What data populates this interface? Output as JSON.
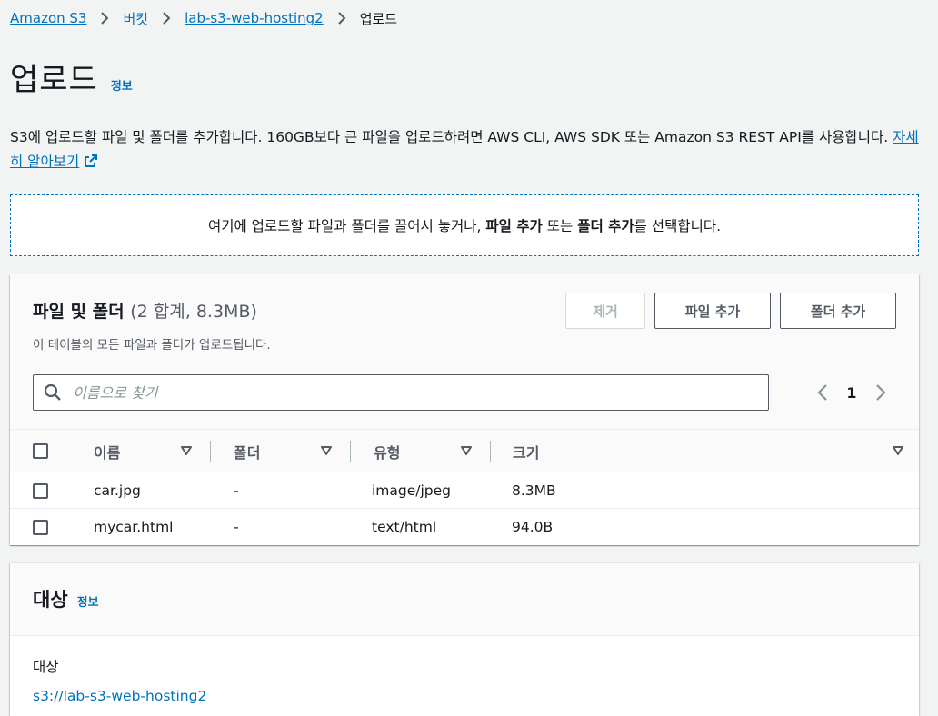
{
  "breadcrumb": {
    "items": [
      "Amazon S3",
      "버킷",
      "lab-s3-web-hosting2"
    ],
    "current": "업로드"
  },
  "header": {
    "title": "업로드",
    "info": "정보"
  },
  "description": {
    "text": "S3에 업로드할 파일 및 폴더를 추가합니다. 160GB보다 큰 파일을 업로드하려면 AWS CLI, AWS SDK 또는 Amazon S3 REST API를 사용합니다.",
    "link": "자세히 알아보기"
  },
  "dropzone": {
    "before": "여기에 업로드할 파일과 폴더를 끌어서 놓거나, ",
    "bold1": "파일 추가",
    "middle": " 또는 ",
    "bold2": "폴더 추가",
    "after": "를 선택합니다."
  },
  "files": {
    "title": "파일 및 폴더",
    "count": "(2 합계, 8.3MB)",
    "subtitle": "이 테이블의 모든 파일과 폴더가 업로드됩니다.",
    "remove_label": "제거",
    "add_files_label": "파일 추가",
    "add_folder_label": "폴더 추가",
    "search_placeholder": "이름으로 찾기",
    "page": "1",
    "columns": [
      "이름",
      "폴더",
      "유형",
      "크기"
    ],
    "rows": [
      {
        "name": "car.jpg",
        "folder": "-",
        "type": "image/jpeg",
        "size": "8.3MB"
      },
      {
        "name": "mycar.html",
        "folder": "-",
        "type": "text/html",
        "size": "94.0B"
      }
    ]
  },
  "destination": {
    "title": "대상",
    "info": "정보",
    "label": "대상",
    "value": "s3://lab-s3-web-hosting2"
  },
  "colors": {
    "link": "#0073bb",
    "text": "#16191f",
    "secondary": "#545b64",
    "background": "#f2f3f3"
  },
  "icons": [
    "chevron-right-icon",
    "external-link-icon",
    "search-icon",
    "chevron-left-icon",
    "caret-down-icon"
  ]
}
